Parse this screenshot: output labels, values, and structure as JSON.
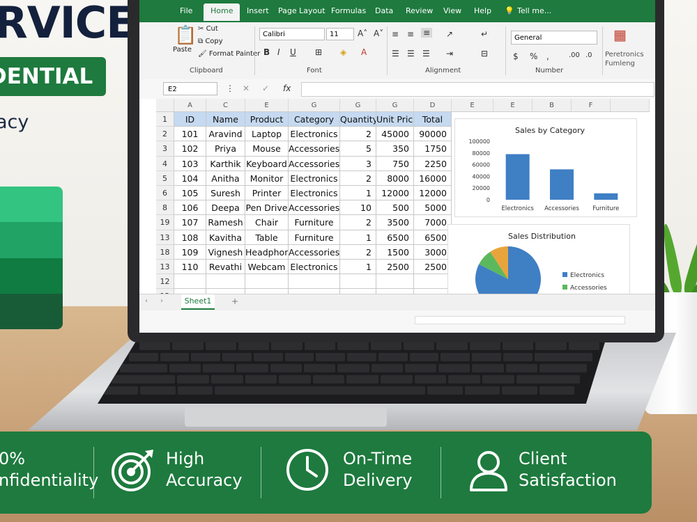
{
  "promo": {
    "title": "RVICE",
    "badge": "DENTIAL",
    "subtitle": "acy"
  },
  "excel": {
    "tabs": [
      "File",
      "Home",
      "Insert",
      "Page Layout",
      "Formulas",
      "Data",
      "Review",
      "View",
      "Help"
    ],
    "active_tab": "Home",
    "tell_me": "Tell me...",
    "clipboard": {
      "paste": "Paste",
      "cut": "Cut",
      "copy": "Copy",
      "format_painter": "Format Painter",
      "label": "Clipboard"
    },
    "font": {
      "name": "Calibri",
      "size": "11",
      "label": "Font"
    },
    "alignment": {
      "label": "Alignment"
    },
    "number": {
      "format": "General",
      "label": "Number"
    },
    "cond_format": "Peretronics Fumleng",
    "name_box": "E2",
    "columns": [
      "A",
      "C",
      "E",
      "G",
      "G",
      "G",
      "D",
      "E",
      "E",
      "B",
      "F"
    ],
    "headers": [
      "ID",
      "Name",
      "Product",
      "Category",
      "Quantity",
      "Unit Price",
      "Total"
    ],
    "rows": [
      [
        "101",
        "Aravind",
        "Laptop",
        "Electronics",
        "2",
        "45000",
        "90000"
      ],
      [
        "102",
        "Priya",
        "Mouse",
        "Accessories",
        "5",
        "350",
        "1750"
      ],
      [
        "103",
        "Karthik",
        "Keyboard",
        "Accessories",
        "3",
        "750",
        "2250"
      ],
      [
        "104",
        "Anitha",
        "Monitor",
        "Electronics",
        "2",
        "8000",
        "16000"
      ],
      [
        "105",
        "Suresh",
        "Printer",
        "Electronics",
        "1",
        "12000",
        "12000"
      ],
      [
        "106",
        "Deepa",
        "Pen Drive",
        "Accessories",
        "10",
        "500",
        "5000"
      ],
      [
        "107",
        "Ramesh",
        "Chair",
        "Furniture",
        "2",
        "3500",
        "7000"
      ],
      [
        "108",
        "Kavitha",
        "Table",
        "Furniture",
        "1",
        "6500",
        "6500"
      ],
      [
        "109",
        "Vignesh",
        "Headphone",
        "Accessories",
        "2",
        "1500",
        "3000"
      ],
      [
        "110",
        "Revathi",
        "Webcam",
        "Electronics",
        "1",
        "2500",
        "2500"
      ]
    ],
    "row_numbers": [
      "1",
      "2",
      "3",
      "4",
      "5",
      "6",
      "8",
      "19",
      "13",
      "18",
      "13",
      "12",
      "12"
    ],
    "sheet_tab": "Sheet1",
    "add_sheet": "+"
  },
  "chart_data": [
    {
      "type": "bar",
      "title": "Sales by Category",
      "categories": [
        "Electronics",
        "Accessories",
        "Furniture"
      ],
      "values": [
        78000,
        52000,
        11000
      ],
      "ylim": [
        0,
        100000
      ],
      "yticks": [
        "100000",
        "80000",
        "60000",
        "40000",
        "20000",
        "0"
      ],
      "color": "#3f7fc4"
    },
    {
      "type": "pie",
      "title": "Sales Distribution",
      "categories": [
        "Electronics",
        "Accessories",
        "Furniture"
      ],
      "values": [
        120500,
        12000,
        13500
      ],
      "colors": [
        "#3f7fc4",
        "#5cb85c",
        "#e8a43c"
      ],
      "legend": "right"
    }
  ],
  "banner": {
    "items": [
      {
        "line1": "0%",
        "line2": "nfidentiality"
      },
      {
        "line1": "High",
        "line2": "Accuracy",
        "icon": "target-icon"
      },
      {
        "line1": "On-Time",
        "line2": "Delivery",
        "icon": "clock-icon"
      },
      {
        "line1": "Client",
        "line2": "Satisfaction",
        "icon": "user-icon"
      }
    ]
  },
  "colors": {
    "excel_green": "#1e7a3e",
    "header_blue": "#c5d9f1",
    "navy": "#14213d"
  }
}
